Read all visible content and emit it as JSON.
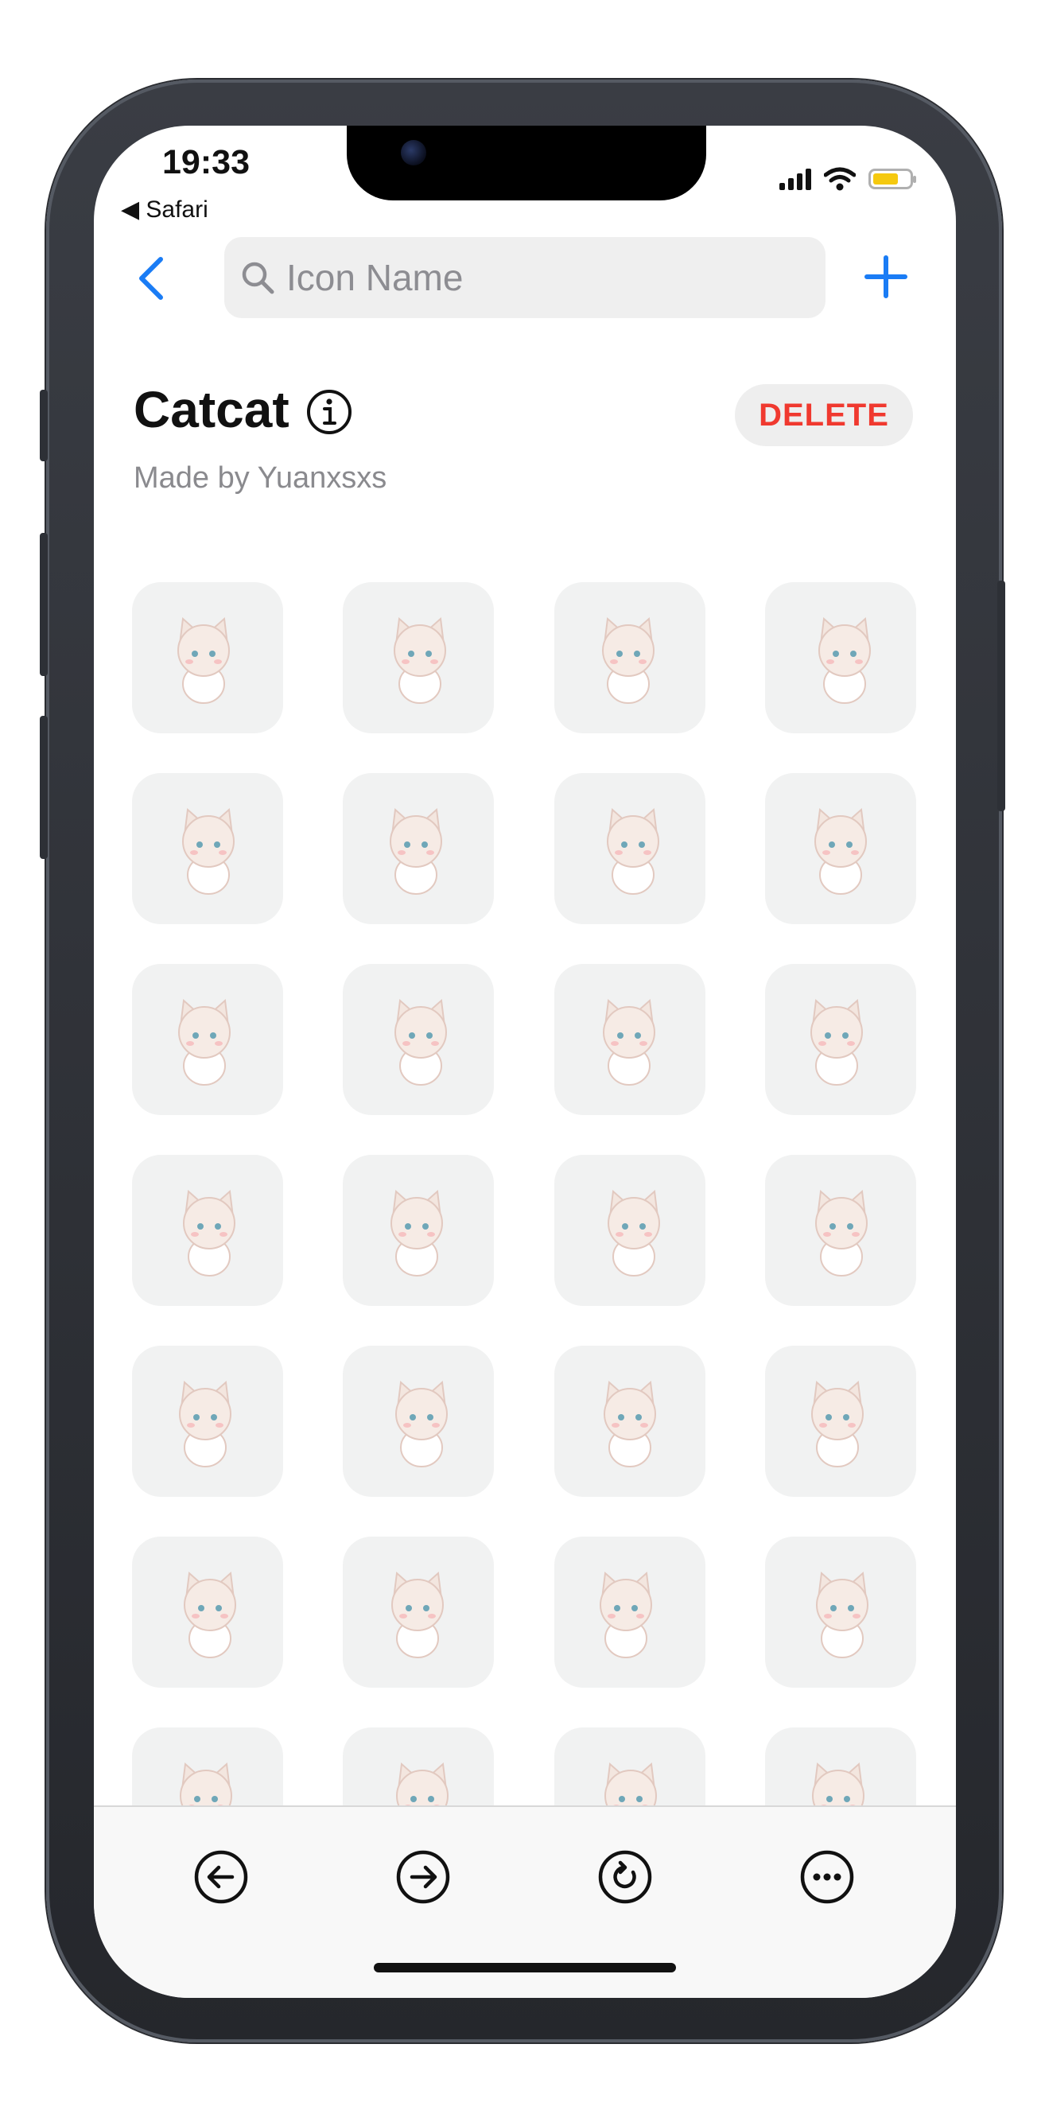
{
  "status_bar": {
    "time": "19:33",
    "back_app": "◀ Safari",
    "battery_color": "#f5c90f"
  },
  "navbar": {
    "back_icon": "chevron-left-icon",
    "search_placeholder": "Icon Name",
    "add_icon": "plus-icon",
    "accent_color": "#1a7cf5"
  },
  "header": {
    "title": "Catcat",
    "info_icon": "info-icon",
    "subtitle": "Made by Yuanxsxs",
    "delete_label": "DELETE",
    "delete_color": "#f0392f"
  },
  "stickers": [
    {
      "name": "sticker-cat-lying-chin"
    },
    {
      "name": "sticker-cat-peek-sparkle"
    },
    {
      "name": "sticker-cat-crying"
    },
    {
      "name": "sticker-cat-standing"
    },
    {
      "name": "sticker-cat-sleeping-pillow"
    },
    {
      "name": "sticker-cat-flowers"
    },
    {
      "name": "sticker-cat-lying-flat"
    },
    {
      "name": "sticker-cat-blanket"
    },
    {
      "name": "sticker-cat-blush"
    },
    {
      "name": "sticker-cat-peek-wall"
    },
    {
      "name": "sticker-cat-waving"
    },
    {
      "name": "sticker-cat-surprised"
    },
    {
      "name": "sticker-milk-bottle"
    },
    {
      "name": "sticker-cat-hearts"
    },
    {
      "name": "sticker-cat-hide-wall"
    },
    {
      "name": "sticker-cat-sitting-plate"
    },
    {
      "name": "sticker-cat-sitting-happy"
    },
    {
      "name": "sticker-cat-rose"
    },
    {
      "name": "sticker-cat-robot-vacuum"
    },
    {
      "name": "sticker-cat-sparkles"
    },
    {
      "name": "sticker-cat-box"
    },
    {
      "name": "sticker-cat-dizzy"
    },
    {
      "name": "sticker-cat-armchair"
    },
    {
      "name": "sticker-cat-thinking"
    },
    {
      "name": "sticker-cat-moon-sleep"
    },
    {
      "name": "sticker-cat-hat"
    },
    {
      "name": "sticker-cat-curled"
    },
    {
      "name": "sticker-cat-halo"
    }
  ],
  "toolbar": {
    "items": [
      {
        "icon": "back-arrow-icon"
      },
      {
        "icon": "forward-arrow-icon"
      },
      {
        "icon": "reload-icon"
      },
      {
        "icon": "more-icon"
      }
    ]
  }
}
